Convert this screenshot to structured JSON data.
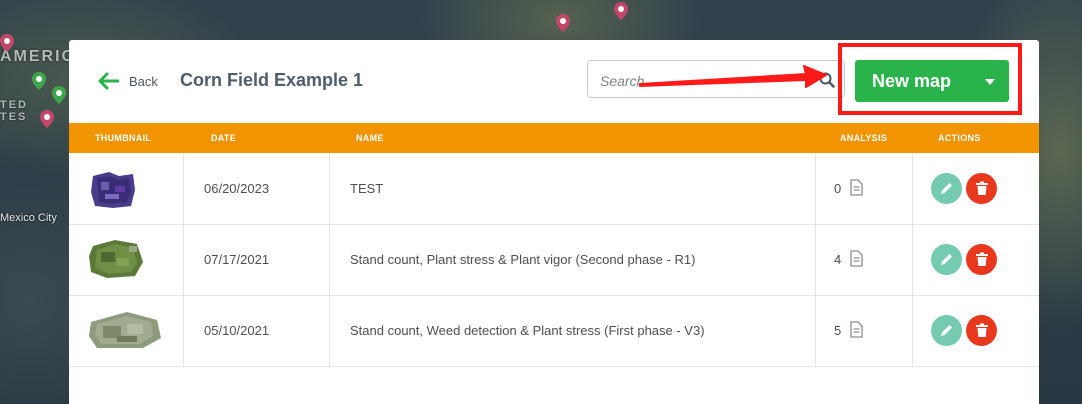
{
  "map": {
    "labels": [
      "AMERICA",
      "TED",
      "TES",
      "Mexico City"
    ]
  },
  "header": {
    "back_label": "Back",
    "title": "Corn Field Example 1",
    "search_placeholder": "Search",
    "new_map_label": "New map"
  },
  "table": {
    "columns": [
      "THUMBNAIL",
      "DATE",
      "NAME",
      "ANALYSIS",
      "ACTIONS"
    ],
    "rows": [
      {
        "date": "06/20/2023",
        "name": "TEST",
        "analysis": "0"
      },
      {
        "date": "07/17/2021",
        "name": "Stand count, Plant stress & Plant vigor (Second phase - R1)",
        "analysis": "4"
      },
      {
        "date": "05/10/2021",
        "name": "Stand count, Weed detection & Plant stress (First phase - V3)",
        "analysis": "5"
      }
    ]
  },
  "colors": {
    "accent_orange": "#f29400",
    "new_map_green": "#2ab34a",
    "edit_teal": "#74cbb2",
    "delete_red": "#e8391f",
    "annotation_red": "#ff1a1a"
  }
}
